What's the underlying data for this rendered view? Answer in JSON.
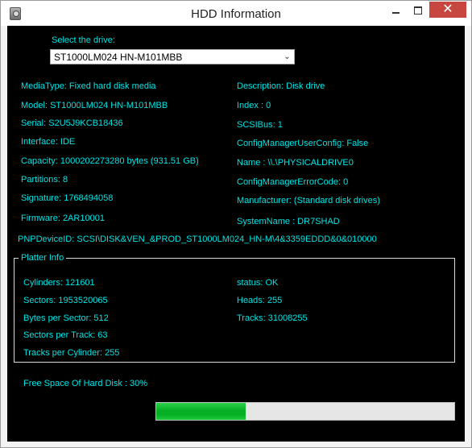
{
  "window": {
    "title": "HDD Information",
    "close_glyph": "✕",
    "icons": {
      "app": "hdd-icon",
      "minimize": "minimize-icon",
      "maximize": "maximize-icon",
      "close": "close-icon"
    }
  },
  "drive_select": {
    "label": "Select the drive:",
    "selected": "ST1000LM024 HN-M101MBB",
    "arrow": "⌄"
  },
  "info": {
    "media_type": "MediaType: Fixed hard disk media",
    "model": "Model: ST1000LM024 HN-M101MBB",
    "serial": "Serial: S2U5J9KCB18436",
    "interface": "Interface: IDE",
    "capacity": "Capacity: 1000202273280 bytes (931.51 GB)",
    "partitions": "Partitions: 8",
    "signature": "Signature: 1768494058",
    "firmware": "Firmware: 2AR10001",
    "description": "Description: Disk drive",
    "index": "Index : 0",
    "scsi_bus": "SCSIBus: 1",
    "config_manager_user_config": "ConfigManagerUserConfig: False",
    "name": "Name : \\\\.\\PHYSICALDRIVE0",
    "config_manager_error_code": "ConfigManagerErrorCode: 0",
    "manufacturer": "Manufacturer: (Standard disk drives)",
    "system_name": "SystemName : DR7SHAD",
    "pnp_device_id": "PNPDeviceID: SCSI\\DISK&VEN_&PROD_ST1000LM024_HN-M\\4&3359EDDD&0&010000"
  },
  "platter": {
    "group_title": "Platter Info",
    "cylinders": "Cylinders: 121601",
    "sectors": "Sectors: 1953520065",
    "bytes_per_sector": "Bytes per Sector: 512",
    "sectors_per_track": "Sectors per Track: 63",
    "tracks_per_cylinder": "Tracks per Cylinder: 255",
    "status": "status: OK",
    "heads": "Heads: 255",
    "tracks": "Tracks: 31008255"
  },
  "free_space": {
    "label": "Free Space Of Hard Disk :  30%",
    "progress_fraction": 0.3
  },
  "colors": {
    "background": "#000000",
    "text": "#00e5e5",
    "progress_fill": "#06b025",
    "progress_track": "#e6e6e6",
    "close_button": "#c7463f"
  }
}
